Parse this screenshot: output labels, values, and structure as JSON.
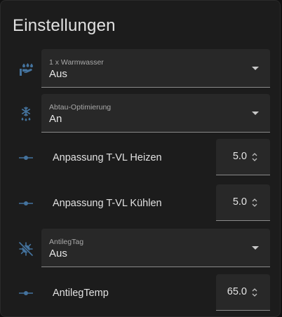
{
  "card": {
    "title": "Einstellungen"
  },
  "rows": [
    {
      "kind": "select",
      "icon": "hand-water-icon",
      "label": "1 x Warmwasser",
      "value": "Aus"
    },
    {
      "kind": "select",
      "icon": "snowflake-melt-icon",
      "label": "Abtau-Optimierung",
      "value": "An"
    },
    {
      "kind": "number",
      "icon": "slider-icon",
      "label": "Anpassung T-VL Heizen",
      "value": "5.0"
    },
    {
      "kind": "number",
      "icon": "slider-icon",
      "label": "Anpassung T-VL Kühlen",
      "value": "5.0"
    },
    {
      "kind": "select",
      "icon": "virus-off-icon",
      "label": "AntilegTag",
      "value": "Aus"
    },
    {
      "kind": "number",
      "icon": "slider-icon",
      "label": "AntilegTemp",
      "value": "65.0"
    }
  ],
  "colors": {
    "icon": "#44739e",
    "card_bg": "#1c1c1c",
    "field_bg": "#282828",
    "text": "#e1e1e1"
  }
}
